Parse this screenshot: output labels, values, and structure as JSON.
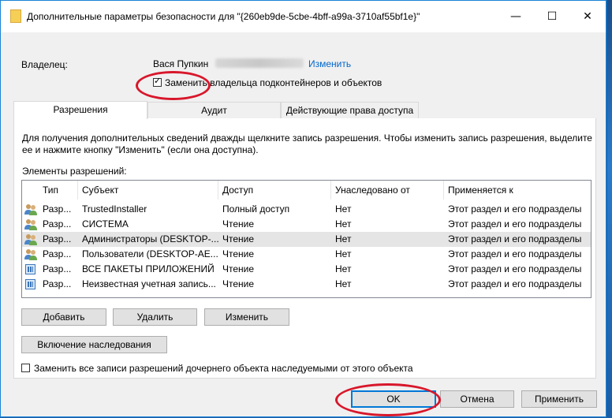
{
  "window": {
    "title": "Дополнительные параметры безопасности  для \"{260eb9de-5cbe-4bff-a99a-3710af55bf1e}\"",
    "minimize": "—",
    "maximize": "☐",
    "close": "✕"
  },
  "owner": {
    "label": "Владелец:",
    "name": "Вася Пупкин",
    "change_link": "Изменить",
    "replace_checkbox_label": "Заменить владельца подконтейнеров и объектов",
    "replace_checked": true
  },
  "tabs": [
    {
      "label": "Разрешения",
      "active": true
    },
    {
      "label": "Аудит",
      "active": false
    },
    {
      "label": "Действующие права доступа",
      "active": false
    }
  ],
  "info_text_line1": "Для получения дополнительных сведений дважды щелкните запись разрешения. Чтобы изменить запись разрешения, выделите",
  "info_text_line2": "ее и нажмите кнопку \"Изменить\" (если она доступна).",
  "entries_label": "Элементы разрешений:",
  "columns": [
    "Тип",
    "Субъект",
    "Доступ",
    "Унаследовано от",
    "Применяется к"
  ],
  "rows": [
    {
      "icon": "users-icon",
      "type": "Разр...",
      "subject": "TrustedInstaller",
      "access": "Полный доступ",
      "inherited": "Нет",
      "applies": "Этот раздел и его подразделы",
      "selected": false
    },
    {
      "icon": "users-icon",
      "type": "Разр...",
      "subject": "СИСТЕМА",
      "access": "Чтение",
      "inherited": "Нет",
      "applies": "Этот раздел и его подразделы",
      "selected": false
    },
    {
      "icon": "users-icon",
      "type": "Разр...",
      "subject": "Администраторы (DESKTOP-...",
      "access": "Чтение",
      "inherited": "Нет",
      "applies": "Этот раздел и его подразделы",
      "selected": true
    },
    {
      "icon": "users-icon",
      "type": "Разр...",
      "subject": "Пользователи (DESKTOP-AE...",
      "access": "Чтение",
      "inherited": "Нет",
      "applies": "Этот раздел и его подразделы",
      "selected": false
    },
    {
      "icon": "package-icon",
      "type": "Разр...",
      "subject": "ВСЕ ПАКЕТЫ ПРИЛОЖЕНИЙ",
      "access": "Чтение",
      "inherited": "Нет",
      "applies": "Этот раздел и его подразделы",
      "selected": false
    },
    {
      "icon": "package-icon",
      "type": "Разр...",
      "subject": "Неизвестная учетная запись...",
      "access": "Чтение",
      "inherited": "Нет",
      "applies": "Этот раздел и его подразделы",
      "selected": false
    }
  ],
  "buttons": {
    "add": "Добавить",
    "remove": "Удалить",
    "edit": "Изменить",
    "enable_inheritance": "Включение наследования",
    "ok": "OK",
    "cancel": "Отмена",
    "apply": "Применить"
  },
  "replace_child_label": "Заменить все записи разрешений дочернего объекта наследуемыми от этого объекта",
  "replace_child_checked": false,
  "annotation_color": "#d8172b",
  "accent_color": "#0078d7"
}
